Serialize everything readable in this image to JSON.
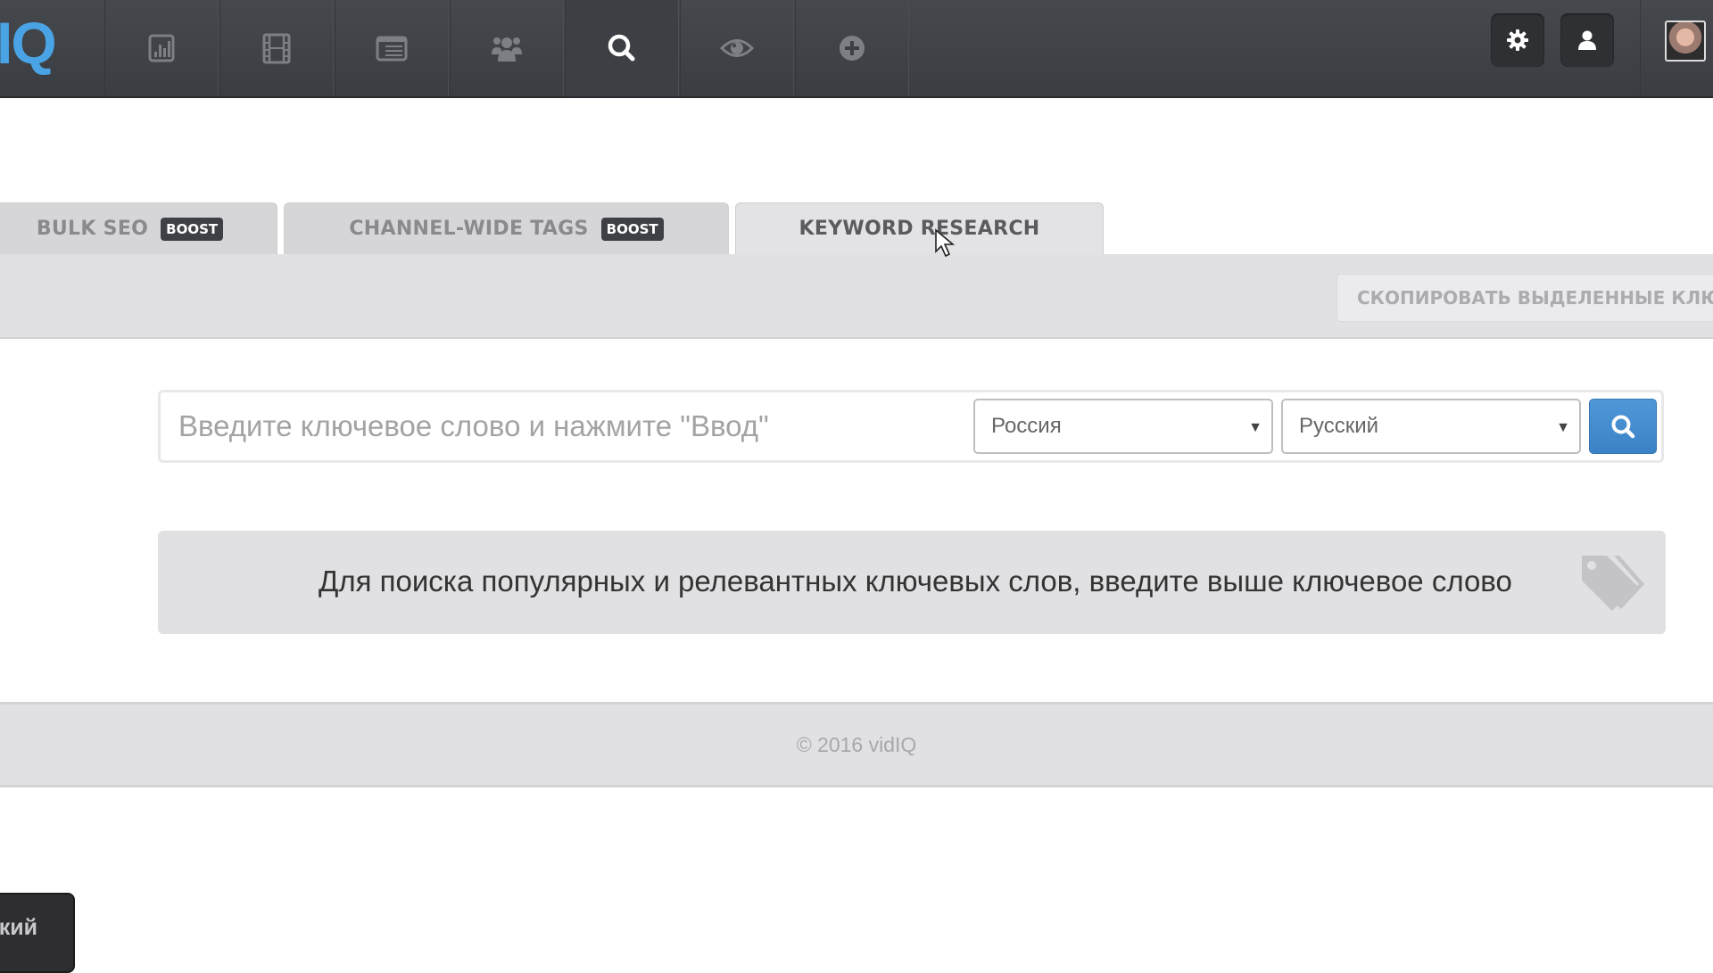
{
  "app": {
    "logo_text": "IQ",
    "brand_color": "#4aa3e4"
  },
  "topnav": {
    "items": [
      {
        "name": "analytics",
        "icon": "bar-chart-icon",
        "active": false
      },
      {
        "name": "videos",
        "icon": "film-icon",
        "active": false
      },
      {
        "name": "list",
        "icon": "list-window-icon",
        "active": false
      },
      {
        "name": "audience",
        "icon": "users-icon",
        "active": false
      },
      {
        "name": "search",
        "icon": "search-icon",
        "active": true
      },
      {
        "name": "watch",
        "icon": "eye-icon",
        "active": false
      },
      {
        "name": "add",
        "icon": "plus-circle-icon",
        "active": false
      }
    ],
    "settings_icon": "gear-icon",
    "account_icon": "user-icon",
    "avatar_icon": "avatar"
  },
  "tabs": [
    {
      "label": "BULK SEO",
      "badge": "BOOST",
      "active": false
    },
    {
      "label": "CHANNEL-WIDE TAGS",
      "badge": "BOOST",
      "active": false
    },
    {
      "label": "KEYWORD RESEARCH",
      "badge": null,
      "active": true
    }
  ],
  "toolbar": {
    "copy_button_label": "СКОПИРОВАТЬ ВЫДЕЛЕННЫЕ КЛЮЧ",
    "copy_button_icon": "paperclip-icon"
  },
  "search": {
    "keyword_value": "",
    "keyword_placeholder": "Введите ключевое слово и нажмите \"Ввод\"",
    "country_selected": "Россия",
    "language_selected": "Русский",
    "search_button_icon": "search-icon",
    "accent_color": "#3f8ccf"
  },
  "info": {
    "message": "Для поиска популярных и релевантных ключевых слов, введите выше ключевое слово",
    "icon": "tags-icon"
  },
  "footer": {
    "copyright": "© 2016 vidIQ"
  },
  "language_popup": {
    "label": "ский"
  }
}
